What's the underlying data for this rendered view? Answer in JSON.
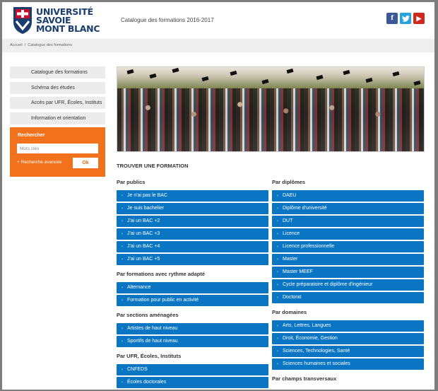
{
  "header": {
    "logo_lines": [
      "UNIVERSITÉ",
      "SAVOIE",
      "MONT BLANC"
    ],
    "catalog_title": "Catalogue des formations 2016-2017",
    "social": [
      "f",
      "t",
      "▶"
    ]
  },
  "breadcrumb": [
    "Accueil",
    "Catalogue des formations"
  ],
  "sidebar": {
    "items": [
      "Catalogue des formations",
      "Schéma des études",
      "Accès par UFR, Écoles, Instituts",
      "Information et orientation"
    ],
    "search_title": "Rechercher",
    "search_placeholder": "Mots clés",
    "advanced_link": "+ Recherche avancée",
    "ok_label": "Ok"
  },
  "main": {
    "title": "TROUVER UNE FORMATION",
    "left": [
      {
        "heading": "Par publics",
        "items": [
          "Je n'ai pas le BAC",
          "Je suis bachelier",
          "J'ai un BAC +2",
          "J'ai un BAC +3",
          "J'ai un BAC +4",
          "J'ai un BAC +5"
        ]
      },
      {
        "heading": "Par formations avec rythme adapté",
        "items": [
          "Alternance",
          "Formation pour public en activité"
        ]
      },
      {
        "heading": "Par sections aménagées",
        "items": [
          "Artistes de haut niveau",
          "Sportifs de haut niveau"
        ]
      },
      {
        "heading": "Par UFR, Écoles, Instituts",
        "items": [
          "CNFEDS",
          "Écoles doctorales"
        ]
      }
    ],
    "right": [
      {
        "heading": "Par diplômes",
        "items": [
          "DAEU",
          "Diplôme d'université",
          "DUT",
          "Licence",
          "Licence professionnelle",
          "Master",
          "Master MEEF",
          "Cycle préparatoire et diplôme d'ingénieur",
          "Doctorat"
        ]
      },
      {
        "heading": "Par domaines",
        "items": [
          "Arts, Lettres, Langues",
          "Droit, Économie, Gestion",
          "Sciences, Technologies, Santé",
          "Sciences humaines et sociales"
        ]
      },
      {
        "heading": "Par champs transversaux",
        "items": []
      }
    ]
  },
  "colors": {
    "accent_blue": "#0a75c2",
    "search_orange": "#f2711c",
    "brand_navy": "#1b3d6e"
  }
}
